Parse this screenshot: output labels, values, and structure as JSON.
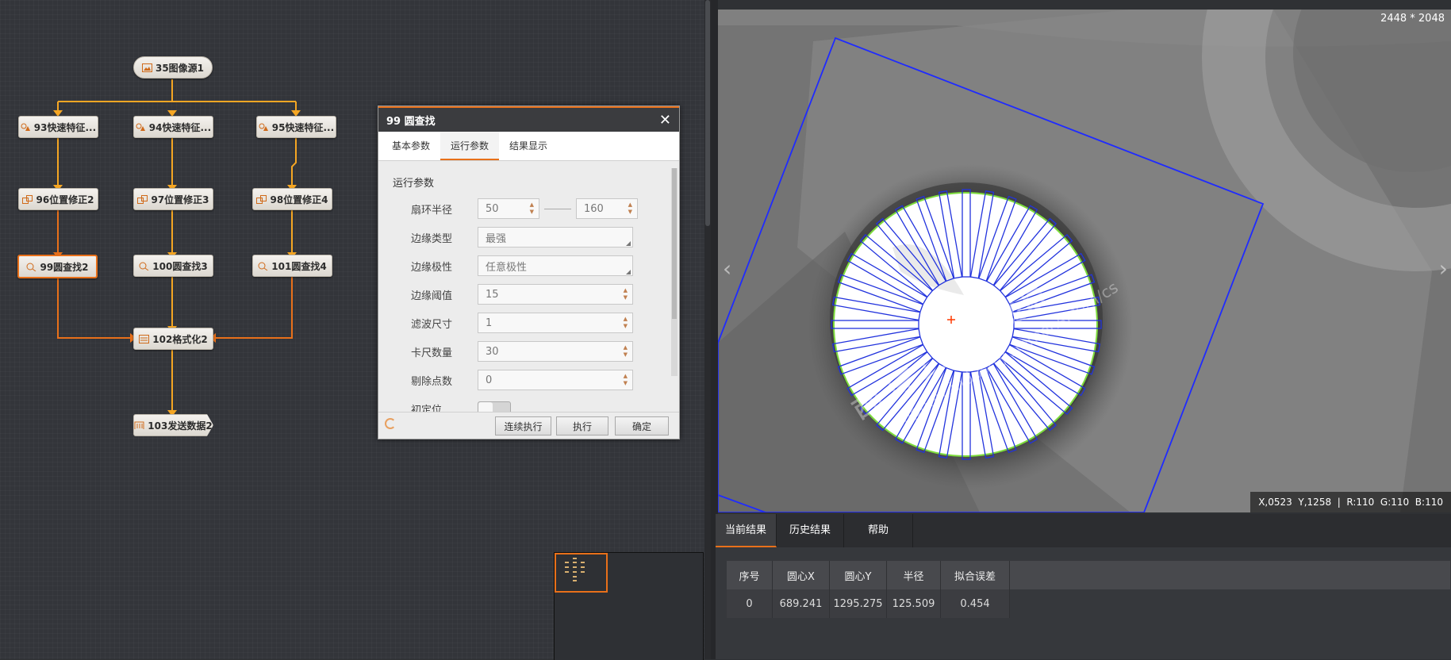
{
  "flow": {
    "nodes": [
      {
        "id": "n35",
        "label": "35图像源1"
      },
      {
        "id": "n93",
        "label": "93快速特征..."
      },
      {
        "id": "n94",
        "label": "94快速特征..."
      },
      {
        "id": "n95",
        "label": "95快速特征..."
      },
      {
        "id": "n96",
        "label": "96位置修正2"
      },
      {
        "id": "n97",
        "label": "97位置修正3"
      },
      {
        "id": "n98",
        "label": "98位置修正4"
      },
      {
        "id": "n99",
        "label": "99圆查找2"
      },
      {
        "id": "n100",
        "label": "100圆查找3"
      },
      {
        "id": "n101",
        "label": "101圆查找4"
      },
      {
        "id": "n102",
        "label": "102格式化2"
      },
      {
        "id": "n103",
        "label": "103发送数据2"
      }
    ]
  },
  "dialog": {
    "title": "99 圆查找",
    "tabs": [
      "基本参数",
      "运行参数",
      "结果显示"
    ],
    "section_title": "运行参数",
    "params": {
      "ring_radius": {
        "label": "扇环半径",
        "min": "50",
        "max": "160"
      },
      "edge_type": {
        "label": "边缘类型",
        "value": "最强"
      },
      "edge_polarity": {
        "label": "边缘极性",
        "value": "任意极性"
      },
      "edge_threshold": {
        "label": "边缘阈值",
        "value": "15"
      },
      "filter_size": {
        "label": "滤波尺寸",
        "value": "1"
      },
      "caliper_count": {
        "label": "卡尺数量",
        "value": "30"
      },
      "reject_points": {
        "label": "剔除点数",
        "value": "0"
      },
      "init_position": {
        "label": "初定位"
      }
    },
    "buttons": {
      "continuous": "连续执行",
      "run": "执行",
      "ok": "确定"
    }
  },
  "image": {
    "resolution": "2448 * 2048",
    "pixel_info": "X,0523  Y,1258  |  R:110  G:110  B:110"
  },
  "results": {
    "tabs": [
      "当前结果",
      "历史结果",
      "帮助"
    ],
    "columns": [
      "序号",
      "圆心X",
      "圆心Y",
      "半径",
      "拟合误差"
    ],
    "rows": [
      [
        "0",
        "689.241",
        "1295.275",
        "125.509",
        "0.454"
      ]
    ]
  }
}
